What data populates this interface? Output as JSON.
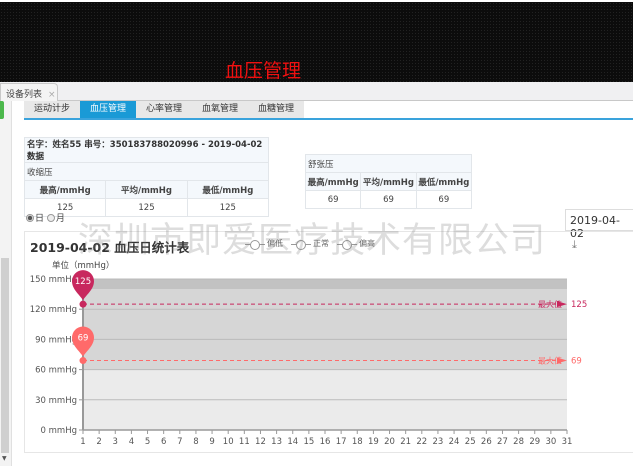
{
  "header": {
    "title": "血压管理"
  },
  "tabstrip": {
    "tab": "设备列表",
    "close": "×"
  },
  "subtabs": [
    {
      "label": "运动计步",
      "active": false
    },
    {
      "label": "血压管理",
      "active": true
    },
    {
      "label": "心率管理",
      "active": false
    },
    {
      "label": "血氧管理",
      "active": false
    },
    {
      "label": "血糖管理",
      "active": false
    }
  ],
  "info": {
    "caption": "名字：姓名55 串号：350183788020996 - 2019-04-02 数据"
  },
  "systolic": {
    "label": "收缩压",
    "headers": [
      "最高/mmHg",
      "平均/mmHg",
      "最低/mmHg"
    ],
    "values": [
      "125",
      "125",
      "125"
    ]
  },
  "diastolic": {
    "label": "舒张压",
    "headers": [
      "最高/mmHg",
      "平均/mmHg",
      "最低/mmHg"
    ],
    "values": [
      "69",
      "69",
      "69"
    ]
  },
  "period": {
    "day": "日",
    "month": "月",
    "selected": "day"
  },
  "date_input": "2019-04-02",
  "watermark": "深圳市即爱医疗技术有限公司",
  "icons": {
    "download": "download-icon"
  },
  "colors": {
    "accent": "#1a9ad6",
    "systolic": "#c8285e",
    "diastolic": "#ff6a6a"
  },
  "chart_data": {
    "type": "line",
    "title": "2019-04-02 血压日统计表",
    "ylabel": "单位（mmHg）",
    "legend": [
      "偏低",
      "正常",
      "偏高"
    ],
    "legend_position": "top-right",
    "x": [
      1,
      2,
      3,
      4,
      5,
      6,
      7,
      8,
      9,
      10,
      11,
      12,
      13,
      14,
      15,
      16,
      17,
      18,
      19,
      20,
      21,
      22,
      23,
      24,
      25,
      26,
      27,
      28,
      29,
      30,
      31
    ],
    "ylim": [
      0,
      150
    ],
    "yticks": [
      "0 mmHg",
      "30 mmHg",
      "60 mmHg",
      "90 mmHg",
      "120 mmHg",
      "150 mmHg"
    ],
    "ytick_values": [
      0,
      30,
      60,
      90,
      120,
      150
    ],
    "bands": [
      {
        "from": 0,
        "to": 60,
        "color": "#ebebeb"
      },
      {
        "from": 60,
        "to": 140,
        "color": "#d6d6d6"
      },
      {
        "from": 140,
        "to": 150,
        "color": "#c2c2c2"
      }
    ],
    "series": [
      {
        "values": [
          {
            "x": 1,
            "y": 125
          }
        ],
        "color": "#c8285e",
        "pin_label": "125",
        "markline": {
          "label": "最大值",
          "value": 125
        }
      },
      {
        "values": [
          {
            "x": 1,
            "y": 69
          }
        ],
        "color": "#ff6a6a",
        "pin_label": "69",
        "markline": {
          "label": "最大值",
          "value": 69
        }
      }
    ]
  }
}
